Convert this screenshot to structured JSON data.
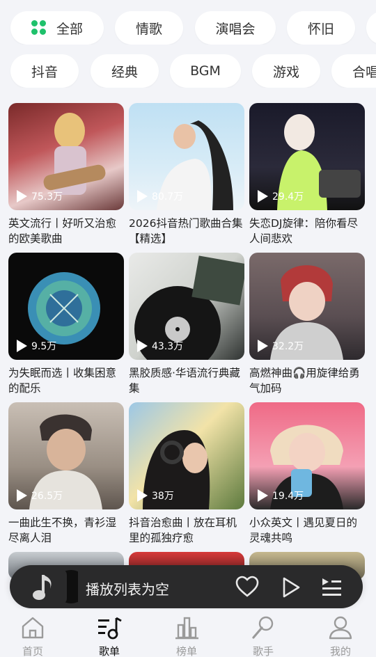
{
  "chips_row1": [
    {
      "label": "全部",
      "icon": "grid-icon",
      "accent": "#1fc16b"
    },
    {
      "label": "情歌"
    },
    {
      "label": "演唱会"
    },
    {
      "label": "怀旧"
    },
    {
      "label": ""
    }
  ],
  "chips_row2": [
    {
      "label": "抖音"
    },
    {
      "label": "经典"
    },
    {
      "label": "BGM"
    },
    {
      "label": "游戏"
    },
    {
      "label": "合唱"
    }
  ],
  "playlists": [
    {
      "title": "英文流行丨好听又治愈的欧美歌曲",
      "plays": "75.3万"
    },
    {
      "title": "2026抖音热门歌曲合集【精选】",
      "plays": "80.7万"
    },
    {
      "title": "失恋DJ旋律：陪你看尽人间悲欢",
      "plays": "29.4万"
    },
    {
      "title": "为失眠而选丨收集困意的配乐",
      "plays": "9.5万"
    },
    {
      "title": "黑胶质感·华语流行典藏集",
      "plays": "43.3万"
    },
    {
      "title": "高燃神曲🎧用旋律给勇气加码",
      "plays": "32.2万"
    },
    {
      "title": "一曲此生不换，青衫湿尽离人泪",
      "plays": "26.5万"
    },
    {
      "title": "抖音治愈曲丨放在耳机里的孤独疗愈",
      "plays": "38万"
    },
    {
      "title": "小众英文丨遇见夏日的灵魂共鸣",
      "plays": "19.4万"
    }
  ],
  "player": {
    "title": "播放列表为空"
  },
  "tabs": [
    {
      "label": "首页",
      "icon": "home-icon"
    },
    {
      "label": "歌单",
      "icon": "playlist-icon",
      "active": true
    },
    {
      "label": "榜单",
      "icon": "chart-icon"
    },
    {
      "label": "歌手",
      "icon": "microphone-icon"
    },
    {
      "label": "我的",
      "icon": "user-icon"
    }
  ]
}
